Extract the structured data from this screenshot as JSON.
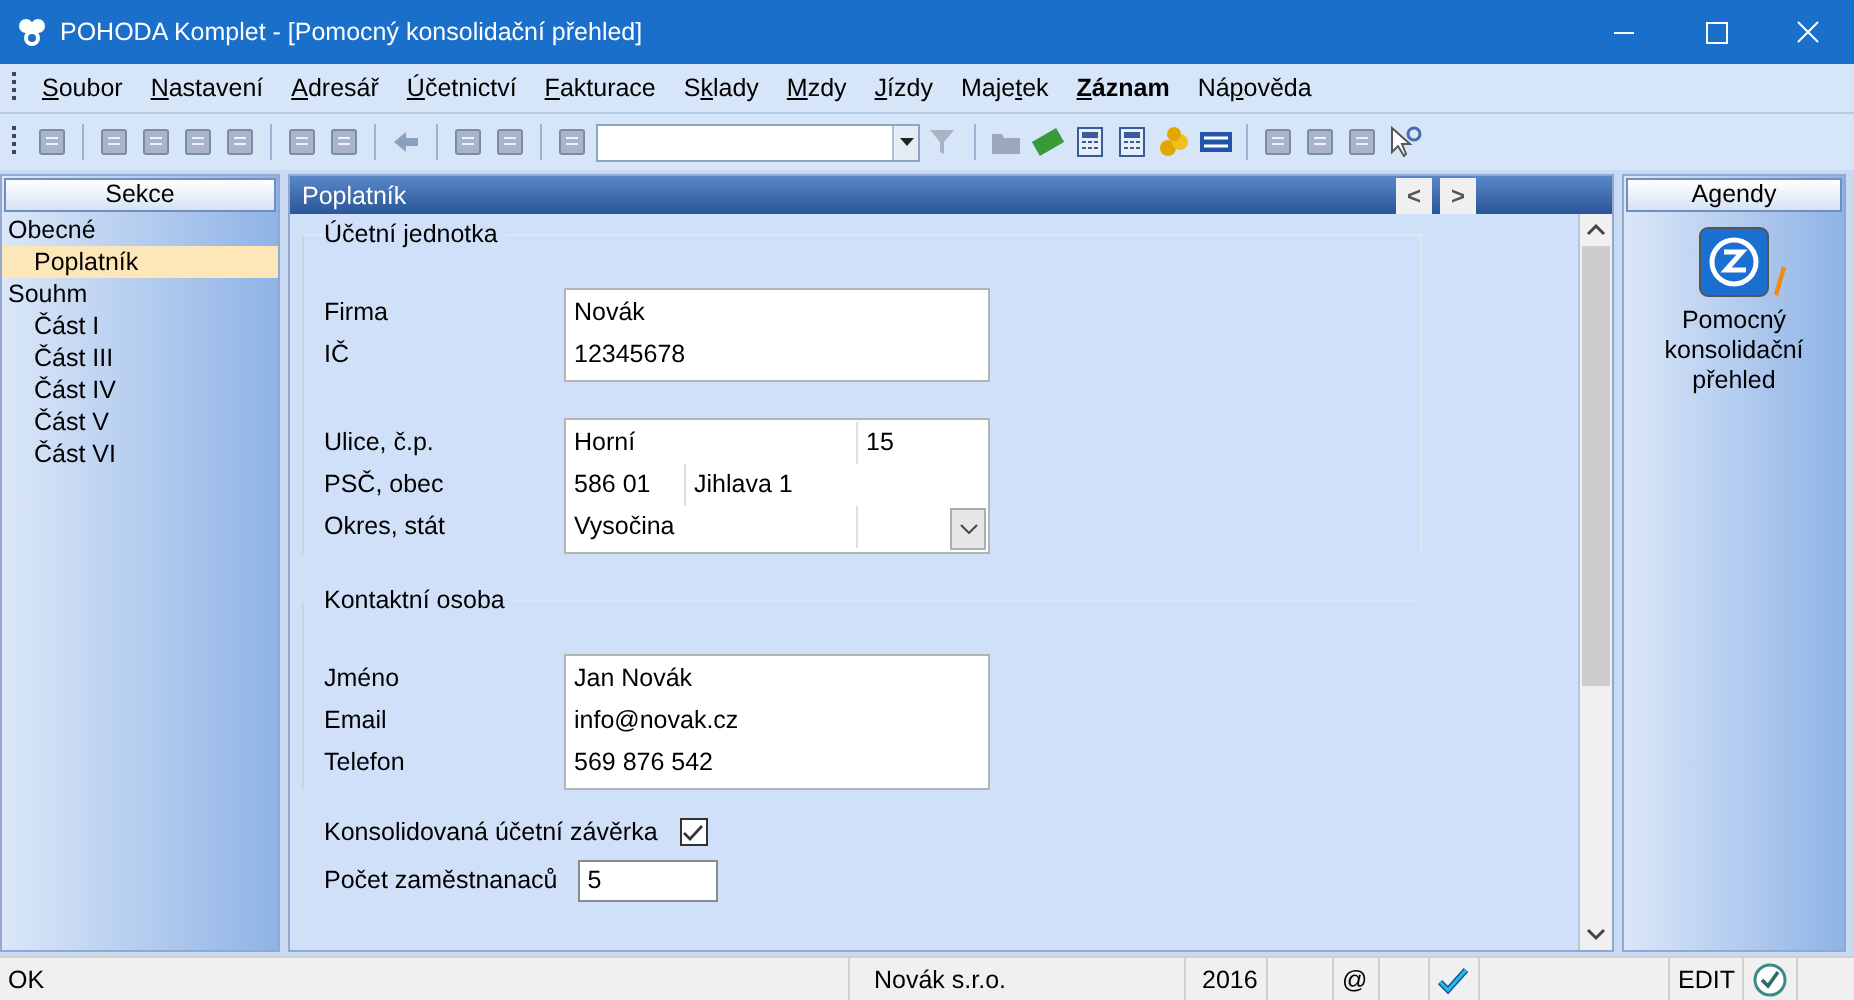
{
  "window": {
    "title": "POHODA Komplet - [Pomocný konsolidační přehled]"
  },
  "menu": [
    {
      "active": false,
      "parts": [
        {
          "text": "S",
          "underlined": true
        },
        {
          "text": "oubor",
          "underlined": false
        }
      ]
    },
    {
      "active": false,
      "parts": [
        {
          "text": "N",
          "underlined": true
        },
        {
          "text": "astavení",
          "underlined": false
        }
      ]
    },
    {
      "active": false,
      "parts": [
        {
          "text": "A",
          "underlined": true
        },
        {
          "text": "dresář",
          "underlined": false
        }
      ]
    },
    {
      "active": false,
      "parts": [
        {
          "text": "Ú",
          "underlined": true
        },
        {
          "text": "četnictví",
          "underlined": false
        }
      ]
    },
    {
      "active": false,
      "parts": [
        {
          "text": "F",
          "underlined": true
        },
        {
          "text": "akturace",
          "underlined": false
        }
      ]
    },
    {
      "active": false,
      "parts": [
        {
          "text": "S",
          "underlined": false
        },
        {
          "text": "k",
          "underlined": true
        },
        {
          "text": "lady",
          "underlined": false
        }
      ]
    },
    {
      "active": false,
      "parts": [
        {
          "text": "M",
          "underlined": true
        },
        {
          "text": "zdy",
          "underlined": false
        }
      ]
    },
    {
      "active": false,
      "parts": [
        {
          "text": "J",
          "underlined": true
        },
        {
          "text": "ízdy",
          "underlined": false
        }
      ]
    },
    {
      "active": false,
      "parts": [
        {
          "text": "Maje",
          "underlined": false
        },
        {
          "text": "t",
          "underlined": true
        },
        {
          "text": "ek",
          "underlined": false
        }
      ]
    },
    {
      "active": true,
      "parts": [
        {
          "text": "Z",
          "underlined": true
        },
        {
          "text": "áznam",
          "underlined": false
        }
      ]
    },
    {
      "active": false,
      "parts": [
        {
          "text": "Ná",
          "underlined": false
        },
        {
          "text": "p",
          "underlined": true
        },
        {
          "text": "ověda",
          "underlined": false
        }
      ]
    }
  ],
  "sections": {
    "header": "Sekce",
    "items": [
      {
        "label": "Obecné",
        "selected": false,
        "children": [
          {
            "label": "Poplatník",
            "selected": true
          }
        ]
      },
      {
        "label": "Souhm",
        "selected": false,
        "children": [
          {
            "label": "Část I",
            "selected": false
          },
          {
            "label": "Část III",
            "selected": false
          },
          {
            "label": "Část IV",
            "selected": false
          },
          {
            "label": "Část V",
            "selected": false
          },
          {
            "label": "Část VI",
            "selected": false
          }
        ]
      }
    ]
  },
  "panel": {
    "title": "Poplatník",
    "prev": "<",
    "next": ">",
    "groups": [
      {
        "title": "Účetní jednotka",
        "blocks": [
          {
            "rows": [
              {
                "kind": "single",
                "label": "Firma",
                "cells": [
                  "Novák"
                ]
              },
              {
                "kind": "single",
                "label": "IČ",
                "cells": [
                  "12345678"
                ]
              }
            ]
          },
          {
            "rows": [
              {
                "kind": "street",
                "label": "Ulice, č.p.",
                "cells": [
                  "Horní",
                  "15"
                ]
              },
              {
                "kind": "city",
                "label": "PSČ, obec",
                "cells": [
                  "586 01",
                  "Jihlava 1"
                ]
              },
              {
                "kind": "region",
                "label": "Okres, stát",
                "cells": [
                  "Vysočina"
                ]
              }
            ]
          }
        ]
      },
      {
        "title": "Kontaktní osoba",
        "blocks": [
          {
            "rows": [
              {
                "kind": "single",
                "label": "Jméno",
                "cells": [
                  "Jan Novák"
                ]
              },
              {
                "kind": "single",
                "label": "Email",
                "cells": [
                  "info@novak.cz"
                ]
              },
              {
                "kind": "single",
                "label": "Telefon",
                "cells": [
                  "569 876 542"
                ]
              }
            ]
          }
        ]
      }
    ],
    "extras": [
      {
        "kind": "checkbox",
        "label": "Konsolidovaná účetní závěrka",
        "checked": true
      },
      {
        "kind": "number",
        "label": "Počet zaměstnanaců",
        "value": "5"
      }
    ]
  },
  "agendas": {
    "header": "Agendy",
    "items": [
      {
        "label": "Pomocný konsolidační přehled"
      }
    ]
  },
  "status_bar": {
    "message": "OK",
    "company": "Novák s.r.o.",
    "year": "2016",
    "mail": "@",
    "mode": "EDIT"
  }
}
